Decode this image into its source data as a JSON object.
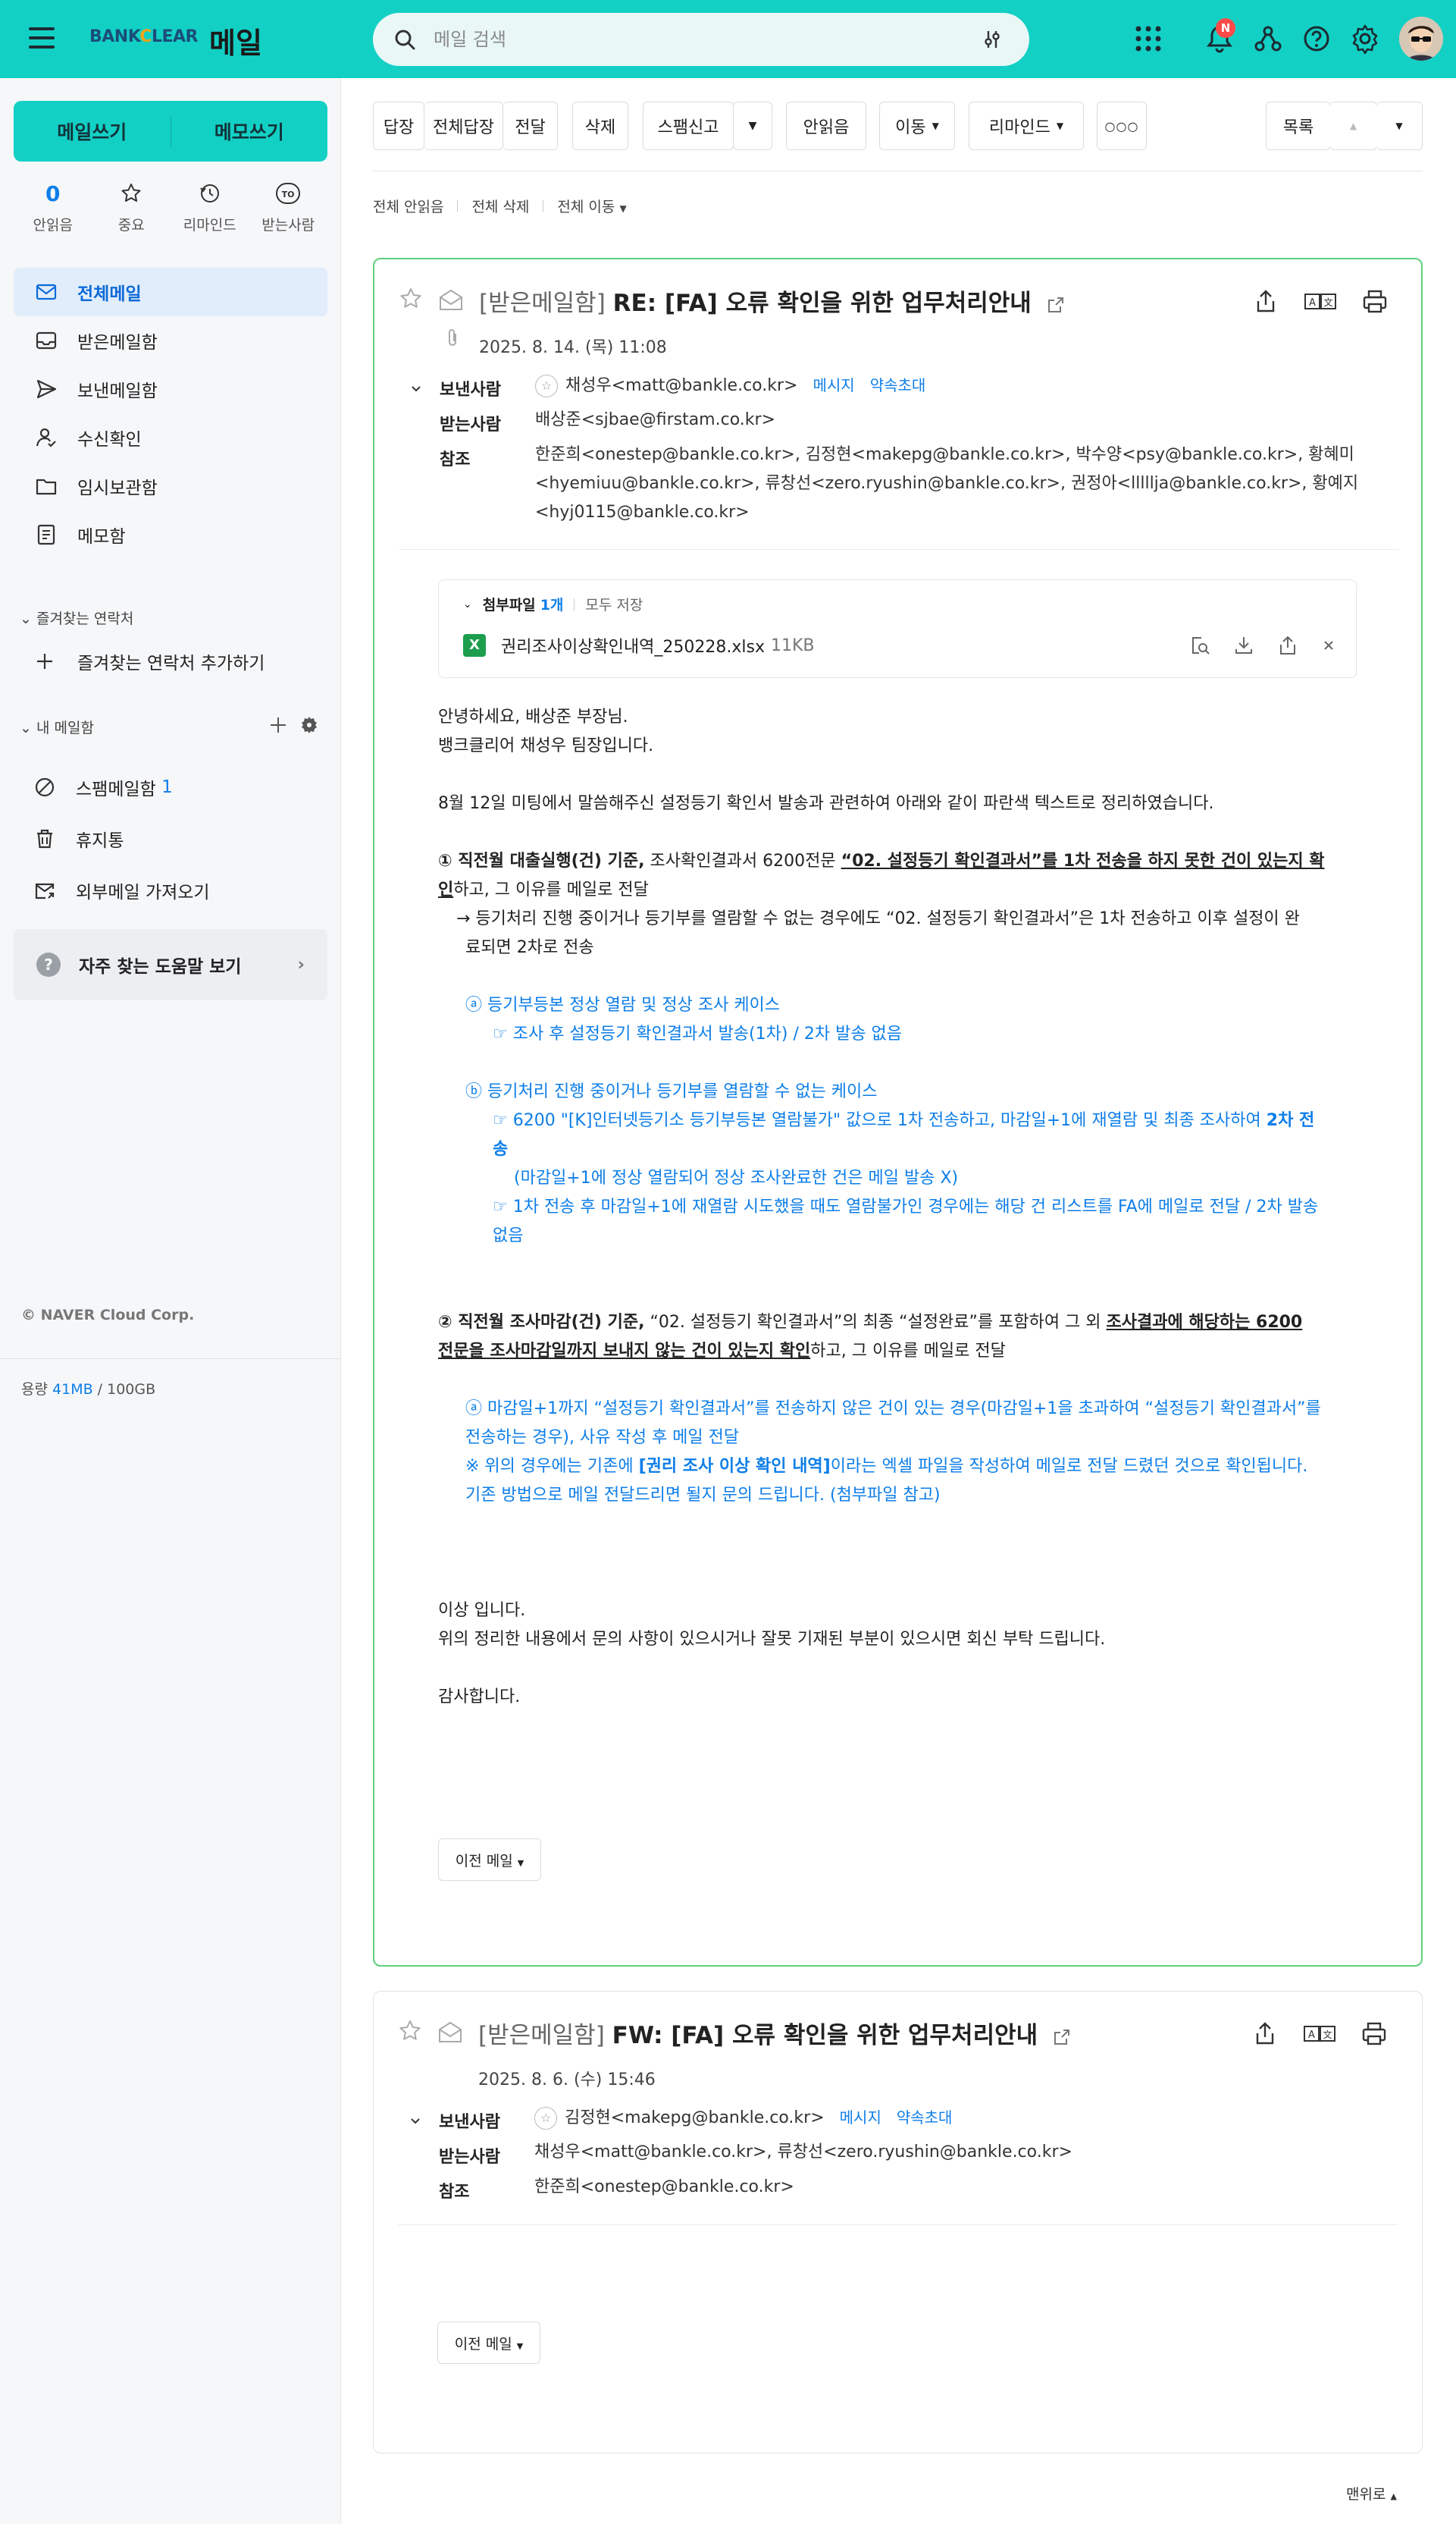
{
  "app": {
    "brand_a": "BANK",
    "brand_c": "C",
    "brand_b": "LEAR",
    "title": "메일"
  },
  "search": {
    "placeholder": "메일 검색",
    "value": ""
  },
  "notification": {
    "badge": "N"
  },
  "sidebar": {
    "compose": "메일쓰기",
    "memo": "메모쓰기",
    "quick": [
      {
        "count": "0",
        "label": "안읽음"
      },
      {
        "label": "중요"
      },
      {
        "label": "리마인드"
      },
      {
        "label": "받는사람"
      }
    ],
    "folders": [
      {
        "label": "전체메일"
      },
      {
        "label": "받은메일함"
      },
      {
        "label": "보낸메일함"
      },
      {
        "label": "수신확인"
      },
      {
        "label": "임시보관함"
      },
      {
        "label": "메모함"
      }
    ],
    "favorites_title": "즐겨찾는 연락처",
    "favorites_add": "즐겨찾는 연락처 추가하기",
    "my_mailbox_title": "내 메일함",
    "mailboxes": [
      {
        "label": "스팸메일함",
        "count": "1"
      },
      {
        "label": "휴지통"
      },
      {
        "label": "외부메일 가져오기"
      }
    ],
    "help": "자주 찾는 도움말 보기",
    "copyright": "© NAVER Cloud Corp.",
    "storage_label": "용량",
    "storage_used": "41MB",
    "storage_total": " / 100GB"
  },
  "toolbar": {
    "reply": "답장",
    "reply_all": "전체답장",
    "forward": "전달",
    "delete": "삭제",
    "spam": "스팸신고",
    "unread": "안읽음",
    "move": "이동",
    "remind": "리마인드",
    "list": "목록"
  },
  "subtoolbar": {
    "all_unread": "전체 안읽음",
    "all_delete": "전체 삭제",
    "all_move": "전체 이동"
  },
  "mail1": {
    "box": "[받은메일함]",
    "subject": "RE: [FA] 오류 확인을 위한 업무처리안내",
    "date": "2025. 8. 14. (목) 11:08",
    "from_label": "보낸사람",
    "from": "채성우<matt@bankle.co.kr>",
    "message_link": "메시지",
    "invite_link": "약속초대",
    "to_label": "받는사람",
    "to": "배상준<sjbae@firstam.co.kr>",
    "cc_label": "참조",
    "cc": "한준희<onestep@bankle.co.kr>, 김정현<makepg@bankle.co.kr>, 박수양<psy@bankle.co.kr>, 황혜미<hyemiuu@bankle.co.kr>, 류창선<zero.ryushin@bankle.co.kr>, 권정아<lllllja@bankle.co.kr>, 황예지<hyj0115@bankle.co.kr>",
    "attach_title": "첨부파일",
    "attach_count": "1개",
    "attach_save_all": "모두 저장",
    "attach_file": "권리조사이상확인내역_250228.xlsx",
    "attach_size": "11KB",
    "body": {
      "greeting1": "안녕하세요, 배상준 부장님.",
      "greeting2": "뱅크클리어 채성우 팀장입니다.",
      "intro": "8월 12일 미팅에서 말씀해주신 설정등기 확인서 발송과 관련하여 아래와 같이 파란색 텍스트로 정리하였습니다.",
      "p1_bold": "① 직전월 대출실행(건) 기준,",
      "p1_mid": " 조사확인결과서 6200전문 ",
      "p1_ub1": "“02. 설정등기 확인결과서”를 ",
      "p1_ub2": "1차 전송을 하지 못한 건이 있는지 확",
      "p1_ub3": "인",
      "p1_end": "하고, 그 이유를 메일로 전달",
      "p1_note1": "→ 등기처리 진행 중이거나 등기부를 열람할 수 없는 경우에도 “02. 설정등기 확인결과서”은 1차 전송하고 이후 설정이 완",
      "p1_note2": "료되면 2차로 전송",
      "a_title": "ⓐ 등기부등본 정상 열람 및 정상 조사 케이스",
      "a_sub": "☞ 조사 후 설정등기 확인결과서 발송(1차) / 2차 발송 없음",
      "b_title": "ⓑ 등기처리 진행 중이거나 등기부를 열람할 수 없는 케이스",
      "b_sub1a": "☞ 6200 \"[K]인터넷등기소 등기부등본 열람불가\" 값으로 1차 전송하고, 마감일+1에 재열람 및 최종 조사하여 ",
      "b_sub1b": "2차 전",
      "b_sub1c": "송",
      "b_sub2": "(마감일+1에 정상 열람되어 정상 조사완료한 건은 메일 발송 X)",
      "b_sub3a": "☞ 1차 전송 후 마감일+1에 재열람 시도했을 때도 열람불가인 경우에는 해당 건 리스트를 FA에 메일로 전달 / 2차 발송",
      "b_sub3b": "없음",
      "p2_bold": "② 직전월 조사마감(건) 기준,",
      "p2_mid": " “02. 설정등기 확인결과서”의 최종 “설정완료”를 포함하여 그 외 ",
      "p2_ub1": "조사결과에 해당하는 6200",
      "p2_ub2": "전문을 조사마감일까지 보내지 않는 건이 있는지 확인",
      "p2_end": "하고, 그 이유를 메일로 전달",
      "c_title1": "ⓐ 마감일+1까지 “설정등기 확인결과서”를 전송하지 않은 건이 있는 경우(마감일+1을 초과하여 “설정등기 확인결과서”를",
      "c_title2": "전송하는 경우), 사유 작성 후 메일 전달",
      "c_note1a": "※ 위의 경우에는 기존에 ",
      "c_note1b": "[권리 조사 이상 확인 내역]",
      "c_note1c": "이라는 엑셀 파일을 작성하여 메일로 전달 드렸던 것으로 확인됩니다.",
      "c_note2": "기존 방법으로 메일 전달드리면 될지 문의 드립니다. (첨부파일 참고)",
      "closing1": "이상 입니다.",
      "closing2": "위의 정리한 내용에서 문의 사항이 있으시거나 잘못 기재된 부분이 있으시면 회신 부탁 드립니다.",
      "closing3": "감사합니다."
    },
    "prev": "이전 메일"
  },
  "mail2": {
    "box": "[받은메일함]",
    "subject": "FW: [FA] 오류 확인을 위한 업무처리안내",
    "date": "2025. 8. 6. (수) 15:46",
    "from_label": "보낸사람",
    "from": "김정현<makepg@bankle.co.kr>",
    "message_link": "메시지",
    "invite_link": "약속초대",
    "to_label": "받는사람",
    "to": "채성우<matt@bankle.co.kr>, 류창선<zero.ryushin@bankle.co.kr>",
    "cc_label": "참조",
    "cc": "한준희<onestep@bankle.co.kr>",
    "prev": "이전 메일"
  },
  "to_top": "맨위로"
}
